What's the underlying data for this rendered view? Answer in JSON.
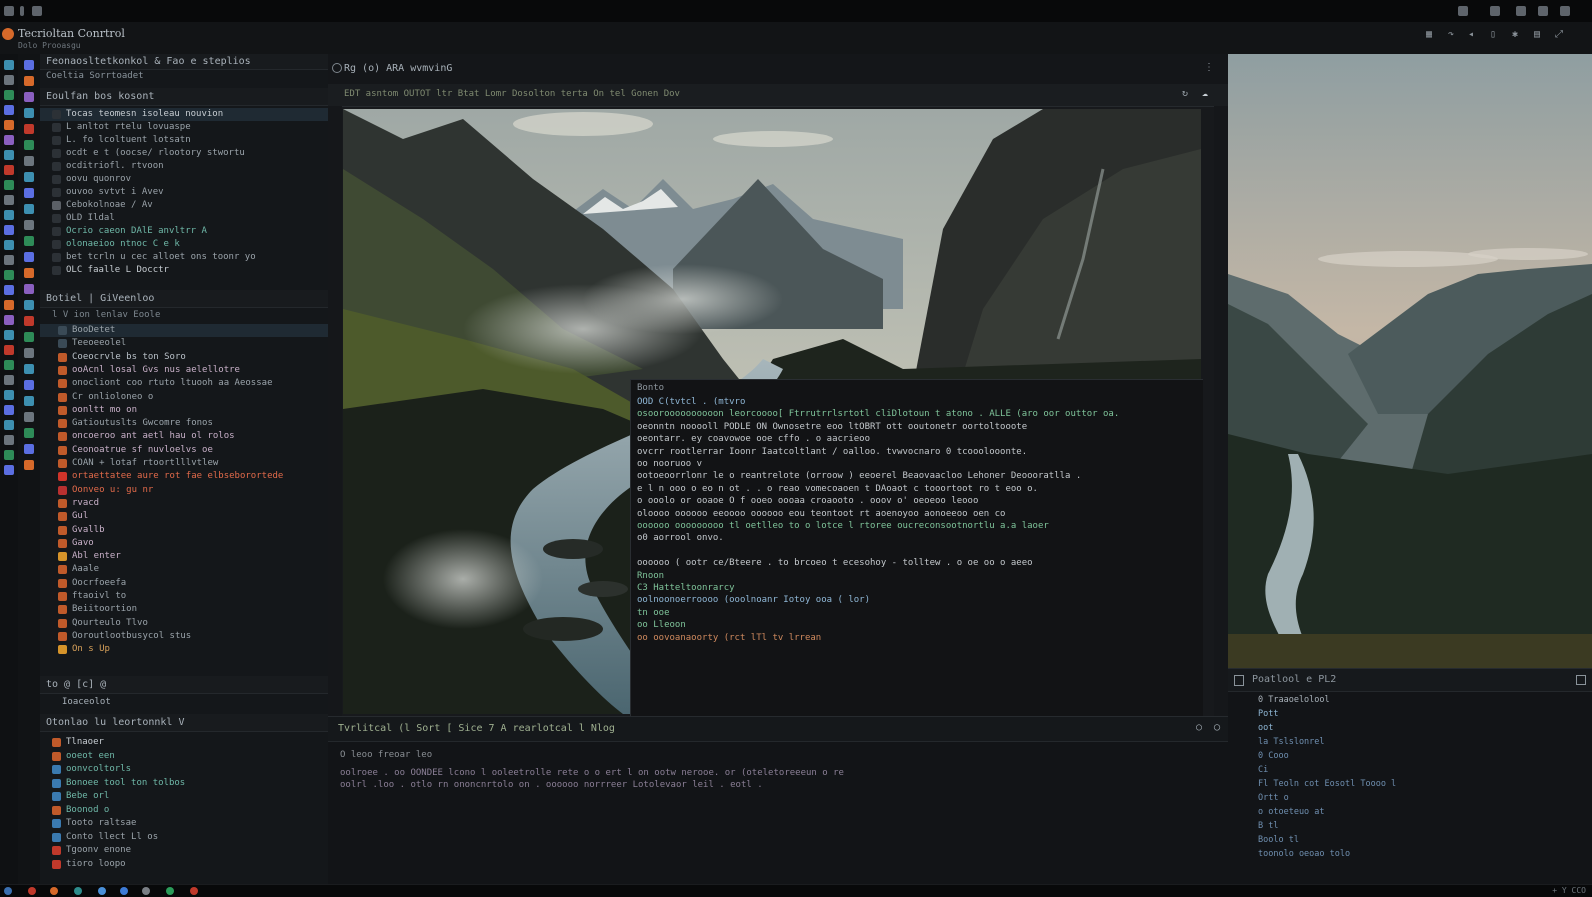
{
  "app": {
    "title": "Tecrioltan Conrtrol",
    "subtitle": "Dolo Prooasgu"
  },
  "sidebar": {
    "header1": "Feonaosltetkonkol & Fao e steplios",
    "header1_sub": "Coeltia Sorrtoadet",
    "section1": "Eoulfan bos kosont",
    "items1": [
      {
        "label": "Tocas teomesn isoleau nouvion"
      },
      {
        "label": "L anltot rtelu lovuaspe"
      },
      {
        "label": "L. fo lcoltuent lotsatn"
      },
      {
        "label": "ocdt e t (oocse/ rlootory stwortu"
      },
      {
        "label": "ocditriofl. rtvoon"
      },
      {
        "label": "oovu quonrov"
      },
      {
        "label": "ouvoo svtvt i Avev"
      },
      {
        "label": "Cebokolnoae / Av"
      },
      {
        "label": "OLD Ildal"
      },
      {
        "label": "Ocrio caeon DAlE anvltrr A"
      },
      {
        "label": "olonaeioo ntnoc C e k"
      },
      {
        "label": "bet tcrln u cec alloet ons toonr yo"
      },
      {
        "label": "OLC faalle L Docctr"
      }
    ],
    "section2": "Botiel | GiVeenloo",
    "section2_sub": "l V ion lenlav Eoole",
    "items2": [
      {
        "label": "BooDetet"
      },
      {
        "label": "Teeoeeolel"
      },
      {
        "label": "Coeocrvle bs ton Soro"
      },
      {
        "label": "ooAcnl losal Gvs nus aelellotre"
      },
      {
        "label": "onocliont coo rtuto ltuooh aa Aeossae"
      },
      {
        "label": "Cr onlioloneo o"
      },
      {
        "label": "oonltt mo on"
      },
      {
        "label": "Gatioutuslts Gwcomre fonos"
      },
      {
        "label": "oncoeroo ant aetl hau ol rolos"
      },
      {
        "label": "Ceonoatrue sf nuvloelvs oe"
      },
      {
        "label": "COAN + lotaf rtoortlllvtlew"
      },
      {
        "label": "ortaettatee aure rot fae  elbseborortede"
      },
      {
        "label": "Oonveo u: gu nr"
      },
      {
        "label": "rvacd"
      },
      {
        "label": "Gul"
      },
      {
        "label": "Gvallb"
      },
      {
        "label": "Gavo"
      },
      {
        "label": "Abl enter"
      },
      {
        "label": "Aaale"
      },
      {
        "label": "Oocrfoeefa"
      },
      {
        "label": "ftaoivl to"
      },
      {
        "label": "Beiitoortion"
      },
      {
        "label": "Qourteulo Tlvo"
      },
      {
        "label": "Ooroutlootbusycol stus"
      },
      {
        "label": "On s Up"
      }
    ],
    "footer_tools": "to @ [c] @",
    "footer_row": "Ioaceolot",
    "section3": "Otonlao lu leortonnkl V",
    "items3": [
      {
        "label": "Tlnaoer"
      },
      {
        "label": "ooeot een"
      },
      {
        "label": "oonvcoltorls"
      },
      {
        "label": "Bonoee tool ton tolbos"
      },
      {
        "label": "Bebe orl"
      },
      {
        "label": "Boonod o"
      },
      {
        "label": "Tooto raltsae"
      },
      {
        "label": "Conto llect Ll os"
      },
      {
        "label": "Tgoonv enone"
      },
      {
        "label": "tioro loopo"
      }
    ]
  },
  "editor": {
    "tab_label": "Rg (o) ARA wvmvinG",
    "toolbar_text": "EDT asntom OUTOT ltr Btat Lomr Dosolton terta On tel Gonen Dov",
    "console_title": "Bonto",
    "console_lines": [
      {
        "text": "OOD C(tvtcl  . (mtvro",
        "color": "#8fb7d6"
      },
      {
        "text": "osooroooooooooon  leorcoooo[ Ftrrutrrlsrtotl cliDlotoun  t atono .  ALLE (aro oor outtor oa.",
        "color": "#7fc49a"
      },
      {
        "text": "oeonntn  nooooll  PODLE ON Ownosetre  eoo  ltOBRT  ott  ooutonetr  oortoltooote",
        "color": "#c3c8cc"
      },
      {
        "text": "oeontarr. ey coavowoe ooe  cffo . o  aacrieoo",
        "color": "#c3c8cc"
      },
      {
        "text": "ovcrr  rootlerrar  Ioonr Iaatcoltlant /  oalloo. tvwvocnaro 0  tcooolooonte.",
        "color": "#c3c8cc"
      },
      {
        "text": "oo nooruoo v",
        "color": "#c3c8cc"
      },
      {
        "text": "ootoeoorrlonr le o   reantrelote (orroow  )  eeoerel Beaovaacloo Lehoner Deoooratlla .",
        "color": "#c3c8cc"
      },
      {
        "text": "e  l n  ooo o  eo n ot .  . o reao  vomecoaoen  t   DAoaot c tooortoot ro t eoo o.",
        "color": "#c3c8cc"
      },
      {
        "text": "o ooolo  or ooaoe  O f  ooeo  oooaa croaooto  .   ooov o' oeoeoo leooo",
        "color": "#c3c8cc"
      },
      {
        "text": "oloooo  oooooo  eeoooo  oooooo  eou teontoot  rt aoenoyoo aonoeeoo oen co",
        "color": "#c3c8cc"
      },
      {
        "text": "oooooo ooooooooo  tl oetlleo to  o lotce l rtoree   oucreconsootnortlu a.a laoer",
        "color": "#7fc49a"
      },
      {
        "text": "o0  aorrool onvo.",
        "color": "#c3c8cc"
      },
      {
        "text": "",
        "color": "#c3c8cc"
      },
      {
        "text": "oooooo  ( ootr ce/Bteere  . to  brcoeo  t  ecesohoy  -  tolltew  .  o oe oo o aeeo",
        "color": "#c3c8cc"
      },
      {
        "text": "Rnoon",
        "color": "#7fc49a"
      },
      {
        "text": "C3 Hatteltoonrarcy",
        "color": "#7fc49a"
      },
      {
        "text": "oolnoonoerroooo (ooolnoanr Iotoy  ooa ( lor)",
        "color": "#8fb7d6"
      },
      {
        "text": "tn  ooe",
        "color": "#7fc49a"
      },
      {
        "text": "oo  Lleoon",
        "color": "#7fc49a"
      },
      {
        "text": "oo  oovoanaoorty  (rct  lTl  tv  lrrean",
        "color": "#d08a5e"
      }
    ]
  },
  "panel": {
    "tabs_text": "Tvrlitcal  (l Sort  [ Sice  7 A rearlotcal  l Nlog",
    "lines": [
      "O  leoo freoar leo",
      "oolroee  . oo   OONDEE  lcono  l ooleetrolle rete o  o ert  l on  ootw  nerooe. or  (oteletoreeeun o re",
      "oolrl .loo  .  otlo  rn   ononcnrtolo on  .  oooooo   norrreer   Lotolevaor   leil  .  eotl ."
    ]
  },
  "rpanel": {
    "title": "Poatlool e PL2",
    "rows": [
      {
        "text": "0  Traaoelolool",
        "color": "#a9b2ba"
      },
      {
        "text": "Pott",
        "color": "#8fb7d6"
      },
      {
        "text": "oot",
        "color": "#8fb7d6"
      },
      {
        "text": "la  Tslslonrel",
        "color": "#6f8fb0"
      },
      {
        "text": "0  Cooo",
        "color": "#6f8fb0"
      },
      {
        "text": "Ci",
        "color": "#6f8fb0"
      },
      {
        "text": "Fl  Teoln cot  Eosotl Toooo  l",
        "color": "#6f8fb0"
      },
      {
        "text": "Ortt o",
        "color": "#6f8fb0"
      },
      {
        "text": "o  otoeteuo  at",
        "color": "#6f8fb0"
      },
      {
        "text": "B  tl",
        "color": "#6f8fb0"
      },
      {
        "text": "Boolo tl",
        "color": "#6f8fb0"
      },
      {
        "text": "toonolo  oeoao  tolo",
        "color": "#6f8fb0"
      }
    ]
  },
  "taskbar": {
    "tray": "+ Y CCO"
  },
  "colors": {
    "accent_orange": "#d6692a",
    "accent_green": "#7fc49a",
    "accent_blue": "#8fb7d6"
  }
}
